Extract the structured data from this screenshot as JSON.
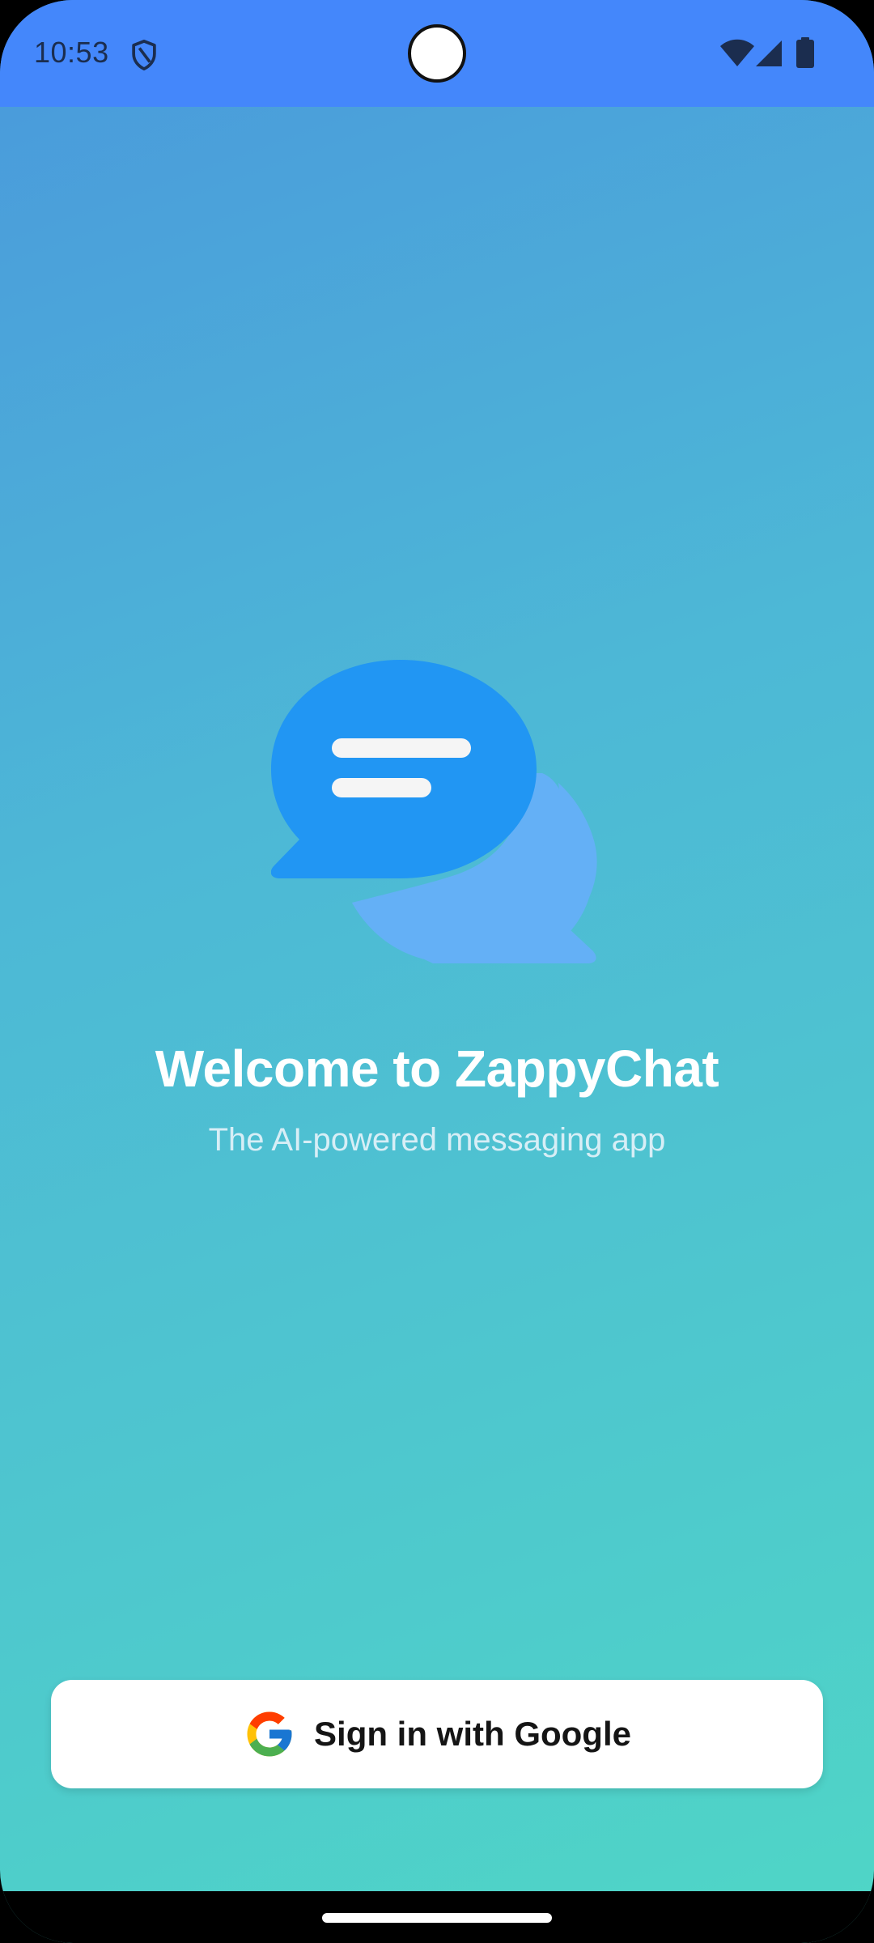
{
  "status_bar": {
    "time": "10:53",
    "icons": [
      "shield-icon",
      "wifi-icon",
      "signal-icon",
      "battery-icon"
    ]
  },
  "logo": {
    "icon": "chat-bubbles-icon",
    "colors": {
      "primary": "#2196f3",
      "secondary": "#64b0f6",
      "lines": "#f5f5f5"
    }
  },
  "welcome": {
    "title": "Welcome to ZappyChat",
    "subtitle": "The AI-powered messaging app"
  },
  "signin": {
    "label": "Sign in with Google",
    "icon": "google-g-icon"
  },
  "theme": {
    "status_bar_color": "#4487fb",
    "gradient_top": "#4a98dc",
    "gradient_bottom": "#4fd6c6"
  }
}
